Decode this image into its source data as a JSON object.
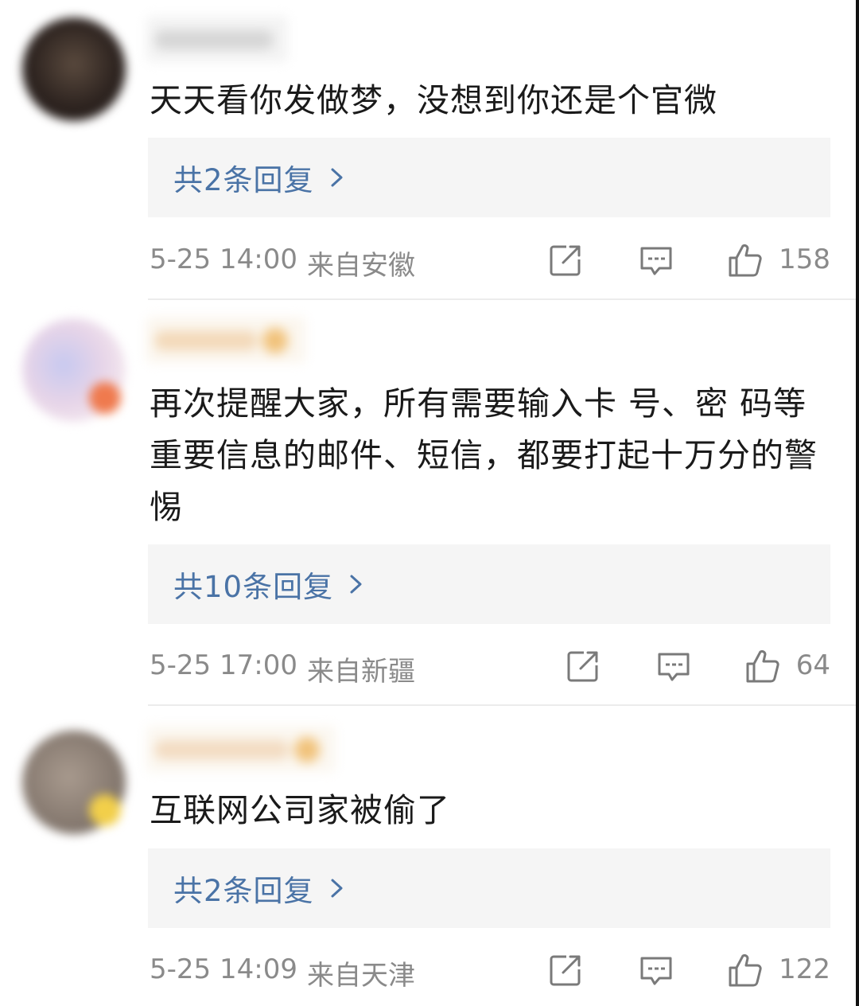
{
  "comments": [
    {
      "text": "天天看你发做梦，没想到你还是个官微",
      "replies_label": "共2条回复",
      "time": "5-25 14:00",
      "location": "来自安徽",
      "likes": "158"
    },
    {
      "text": "再次提醒大家，所有需要输入卡 号、密 码等重要信息的邮件、短信，都要打起十万分的警惕",
      "replies_label": "共10条回复",
      "time": "5-25 17:00",
      "location": "来自新疆",
      "likes": "64"
    },
    {
      "text": "互联网公司家被偷了",
      "replies_label": "共2条回复",
      "time": "5-25 14:09",
      "location": "来自天津",
      "likes": "122"
    }
  ],
  "colors": {
    "reply_link": "#4a73a6",
    "meta_text": "#8a8a8a",
    "reply_bg": "#f5f5f5"
  },
  "icons": [
    "share-icon",
    "comment-icon",
    "like-icon",
    "chevron-right-icon"
  ]
}
